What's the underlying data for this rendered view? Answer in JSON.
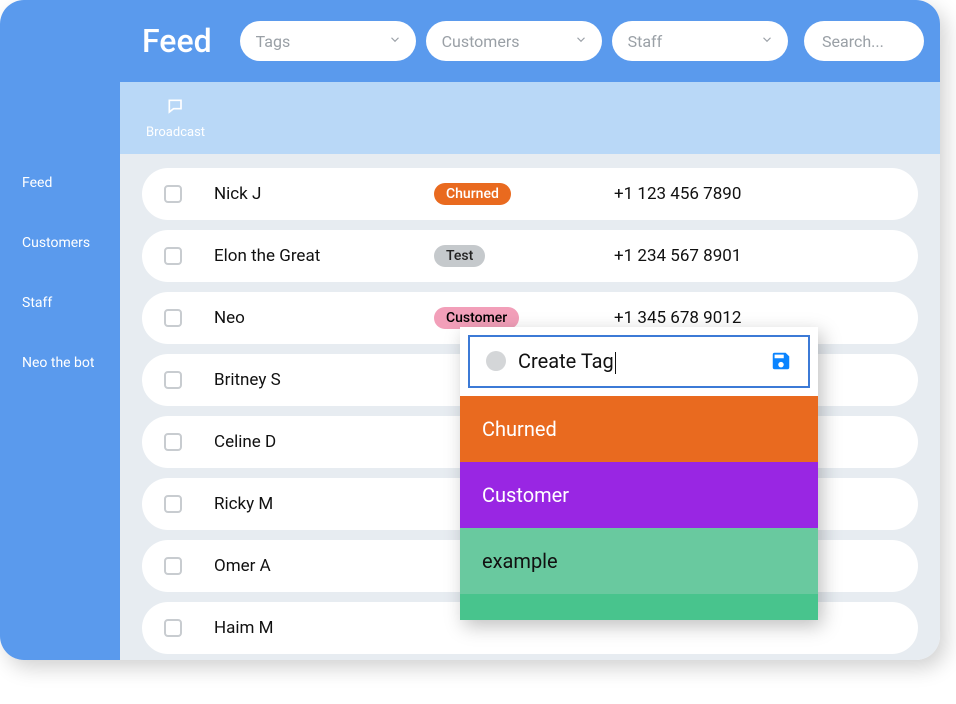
{
  "header": {
    "title": "Feed",
    "filters": {
      "tags": "Tags",
      "customers": "Customers",
      "staff": "Staff"
    },
    "search_placeholder": "Search..."
  },
  "sidebar": {
    "items": [
      {
        "label": "Feed"
      },
      {
        "label": "Customers"
      },
      {
        "label": "Staff"
      },
      {
        "label": "Neo the bot"
      }
    ]
  },
  "subheader": {
    "broadcast_label": "Broadcast"
  },
  "rows": [
    {
      "name": "Nick J",
      "tag": "Churned",
      "tag_class": "tag-churned",
      "phone": "+1 123 456 7890"
    },
    {
      "name": "Elon the Great",
      "tag": "Test",
      "tag_class": "tag-test",
      "phone": "+1 234 567 8901"
    },
    {
      "name": "Neo",
      "tag": "Customer",
      "tag_class": "tag-customer",
      "phone": "+1 345 678 9012"
    },
    {
      "name": "Britney S",
      "tag": "",
      "tag_class": "",
      "phone": ""
    },
    {
      "name": "Celine D",
      "tag": "",
      "tag_class": "",
      "phone": ""
    },
    {
      "name": "Ricky M",
      "tag": "",
      "tag_class": "",
      "phone": ""
    },
    {
      "name": "Omer A",
      "tag": "",
      "tag_class": "",
      "phone": ""
    },
    {
      "name": "Haim M",
      "tag": "",
      "tag_class": "",
      "phone": ""
    }
  ],
  "tag_popup": {
    "create_label": "Create Tag",
    "items": [
      {
        "label": "Churned",
        "class": "tp-churned"
      },
      {
        "label": "Customer",
        "class": "tp-customer"
      },
      {
        "label": "example",
        "class": "tp-example"
      }
    ]
  },
  "colors": {
    "primary": "#5a9aed",
    "subheader": "#b9d8f7",
    "content_bg": "#e7ecf1"
  }
}
